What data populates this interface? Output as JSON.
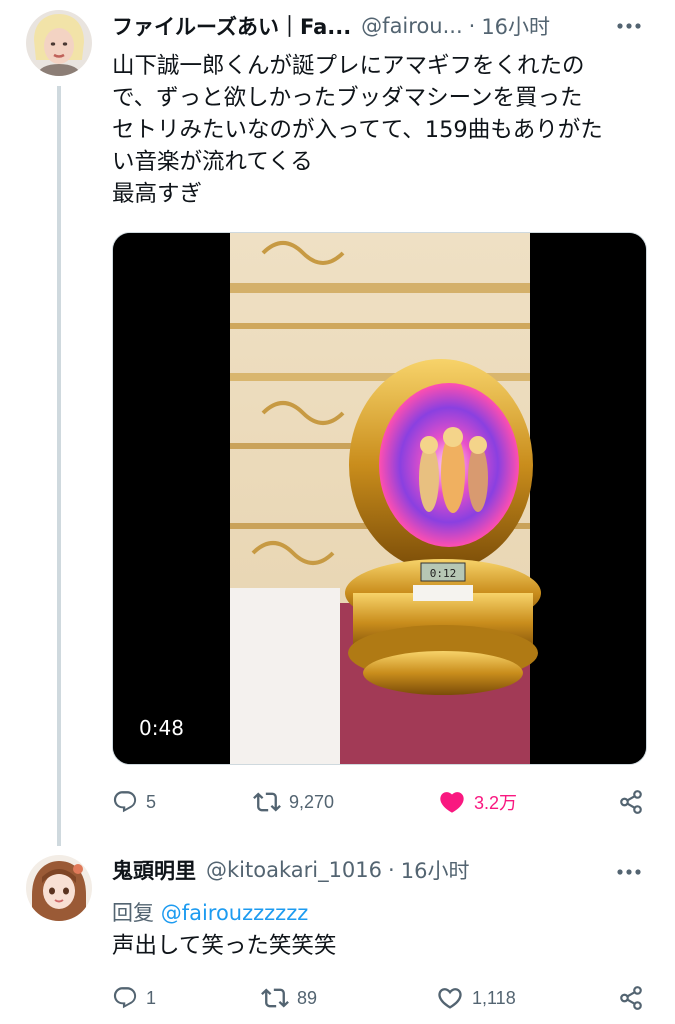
{
  "tweet1": {
    "display_name": "ファイルーズあい｜Fa...",
    "handle": "@fairou...",
    "separator": "·",
    "time": "16小时",
    "lines": [
      "山下誠一郎くんが誕プレにアマギフをくれたの",
      "で、ずっと欲しかったブッダマシーンを買った",
      "セトリみたいなのが入ってて、159曲もありがた",
      "い音楽が流れてくる",
      "最高すぎ"
    ],
    "video_duration": "0:48",
    "video_lcd": "0:12",
    "actions": {
      "replies": "5",
      "retweets": "9,270",
      "likes": "3.2万"
    }
  },
  "tweet2": {
    "display_name": "鬼頭明里",
    "handle": "@kitoakari_1016",
    "separator": "·",
    "time": "16小时",
    "reply_prefix": "回复",
    "reply_mention": "@fairouzzzzzz",
    "text": "声出して笑った笑笑笑",
    "actions": {
      "replies": "1",
      "retweets": "89",
      "likes": "1,118"
    }
  },
  "colors": {
    "text": "#0f1419",
    "secondary": "#536471",
    "link": "#1d9bf0",
    "like": "#f91880",
    "thread_line": "#cfd9de"
  },
  "icons": [
    "more-icon",
    "reply-icon",
    "retweet-icon",
    "like-icon",
    "share-icon"
  ]
}
